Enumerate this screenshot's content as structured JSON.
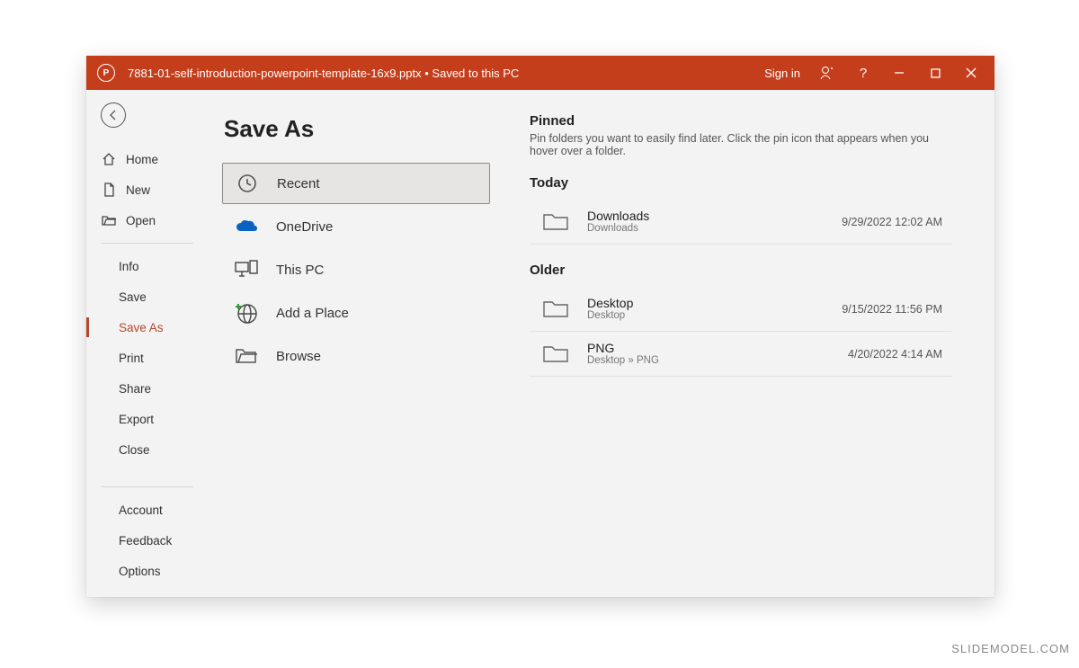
{
  "titlebar": {
    "filename": "7881-01-self-introduction-powerpoint-template-16x9.pptx",
    "save_status": "Saved to this PC",
    "signin": "Sign in"
  },
  "sidebar": {
    "home": "Home",
    "new": "New",
    "open": "Open",
    "info": "Info",
    "save": "Save",
    "save_as": "Save As",
    "print": "Print",
    "share": "Share",
    "export": "Export",
    "close": "Close",
    "account": "Account",
    "feedback": "Feedback",
    "options": "Options"
  },
  "page": {
    "title": "Save As"
  },
  "locations": {
    "recent": "Recent",
    "onedrive": "OneDrive",
    "this_pc": "This PC",
    "add_place": "Add a Place",
    "browse": "Browse"
  },
  "right": {
    "pinned_h": "Pinned",
    "pinned_sub": "Pin folders you want to easily find later. Click the pin icon that appears when you hover over a folder.",
    "today_h": "Today",
    "older_h": "Older",
    "folders": {
      "downloads": {
        "name": "Downloads",
        "path": "Downloads",
        "time": "9/29/2022 12:02 AM"
      },
      "desktop": {
        "name": "Desktop",
        "path": "Desktop",
        "time": "9/15/2022 11:56 PM"
      },
      "png": {
        "name": "PNG",
        "path": "Desktop » PNG",
        "time": "4/20/2022 4:14 AM"
      }
    }
  },
  "watermark": "SLIDEMODEL.COM"
}
